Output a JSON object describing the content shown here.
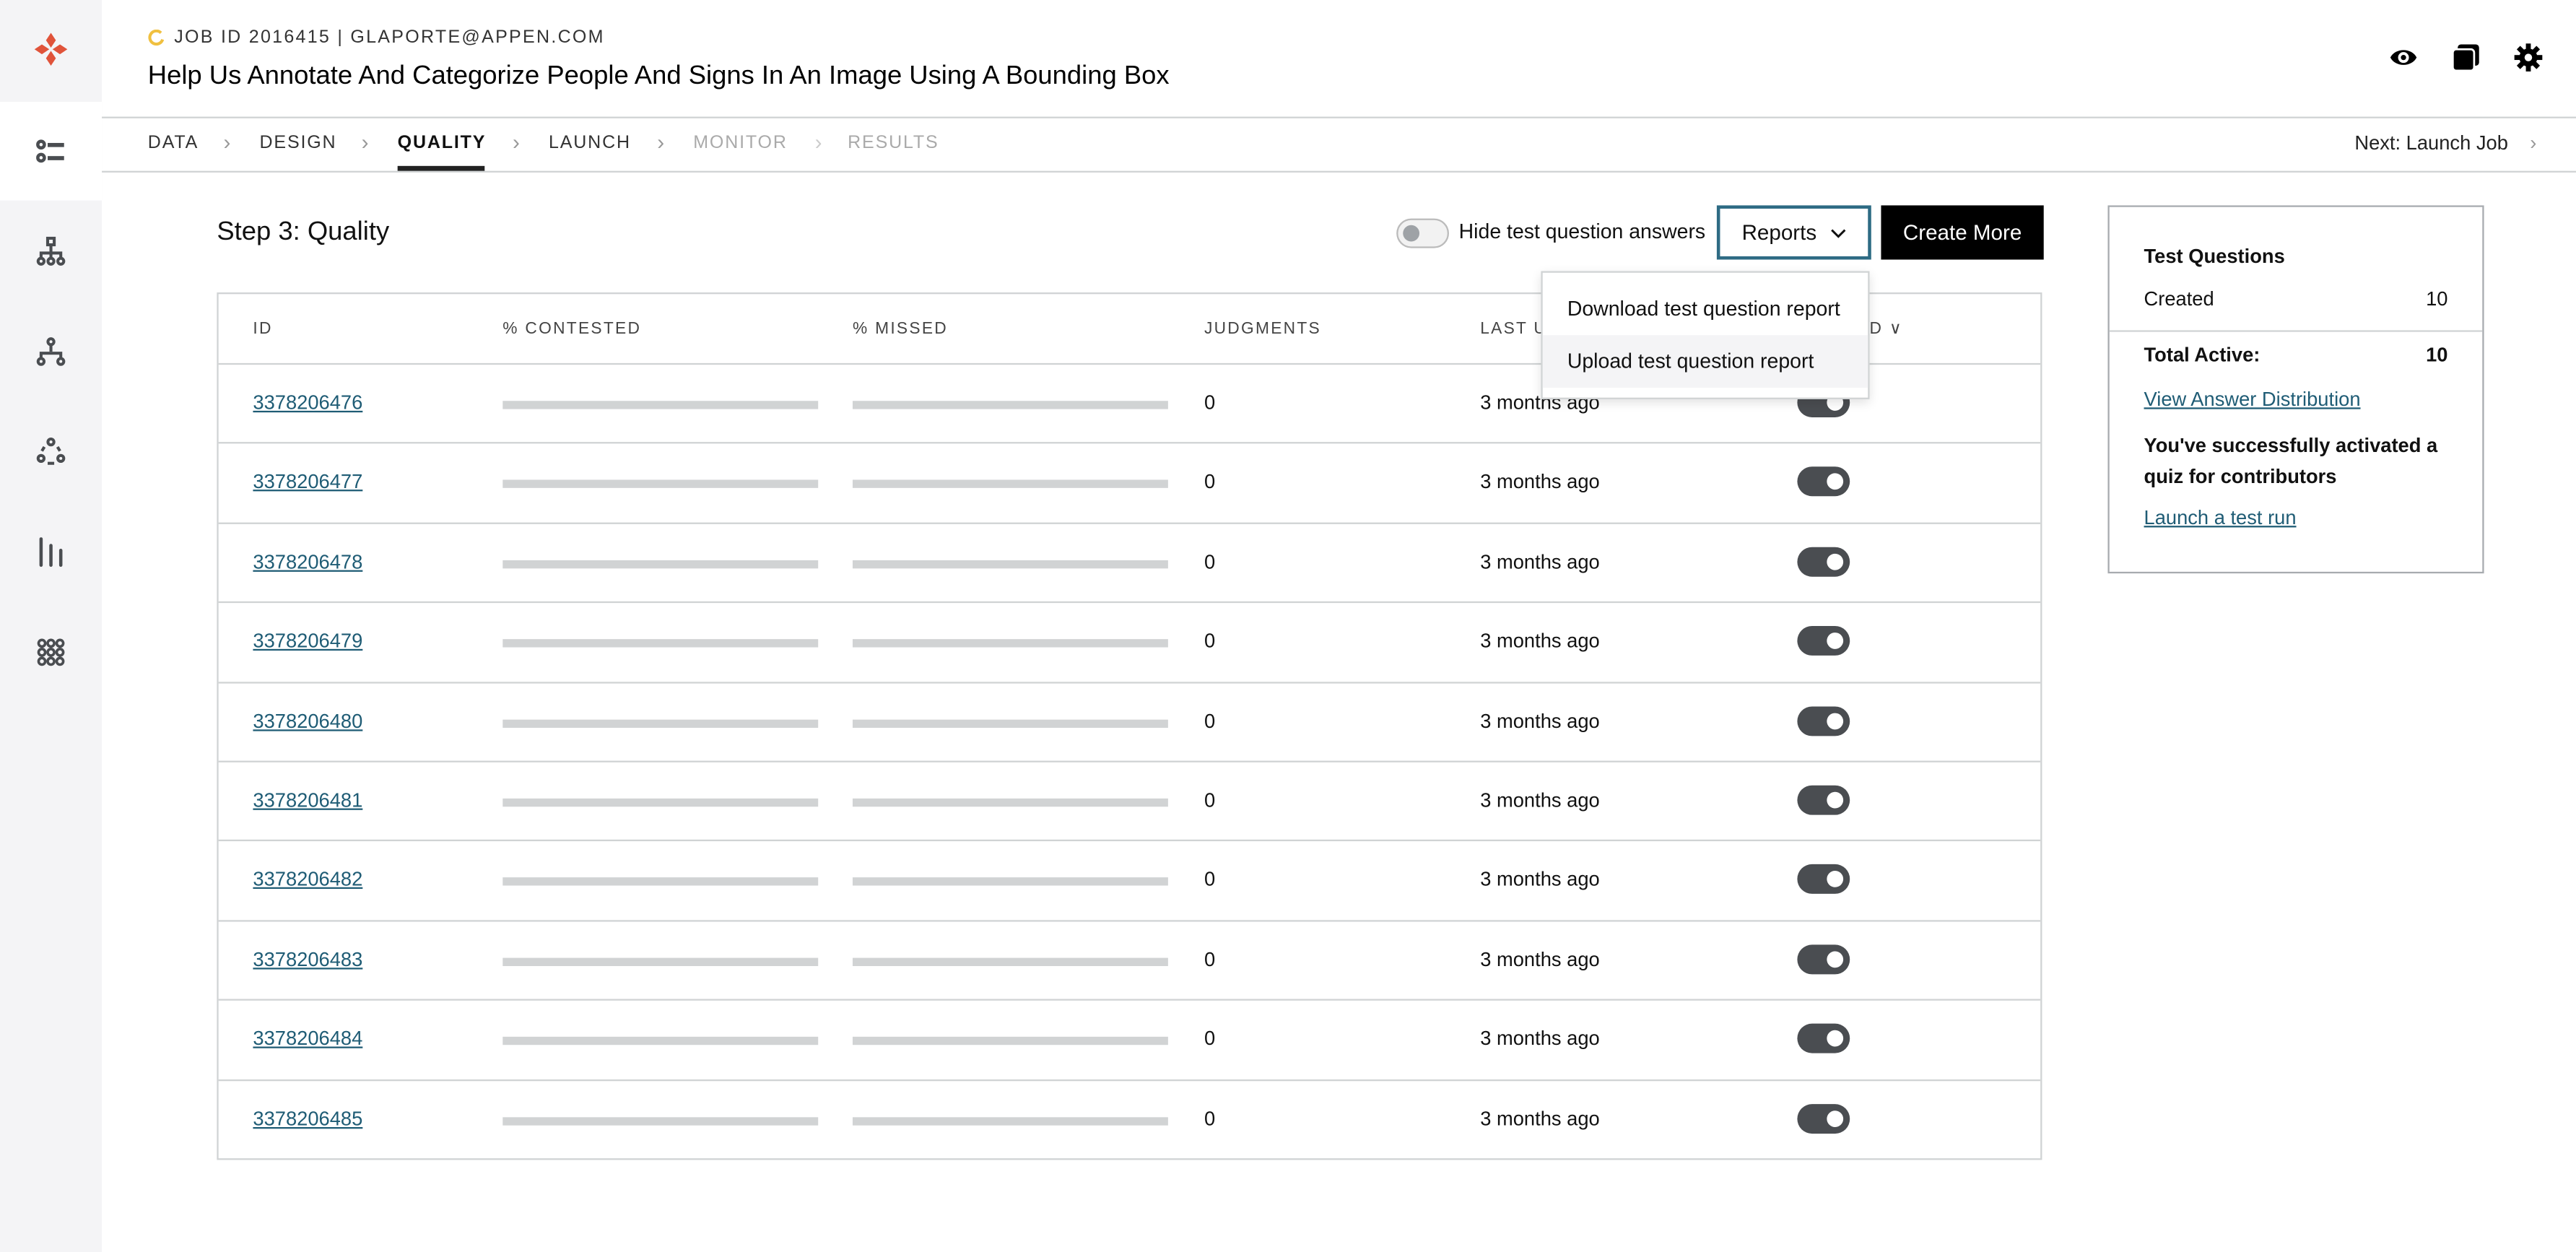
{
  "header": {
    "job_line": "JOB ID 2016415 | GLAPORTE@APPEN.COM",
    "title": "Help Us Annotate And Categorize People And Signs In An Image Using A Bounding Box",
    "icons": [
      "eye-icon",
      "copy-icon",
      "gear-icon"
    ]
  },
  "colors": {
    "brand": "#e0533a",
    "link": "#1f5c75",
    "status_spinner": "#f0c040"
  },
  "nav": {
    "tabs": [
      {
        "label": "DATA",
        "state": "done"
      },
      {
        "label": "DESIGN",
        "state": "done"
      },
      {
        "label": "QUALITY",
        "state": "active"
      },
      {
        "label": "LAUNCH",
        "state": "done"
      },
      {
        "label": "MONITOR",
        "state": "disabled"
      },
      {
        "label": "RESULTS",
        "state": "disabled"
      }
    ],
    "next": "Next: Launch Job"
  },
  "main": {
    "step_title": "Step 3: Quality",
    "hide_toggle_label": "Hide test question answers",
    "hide_toggle_on": false,
    "reports_label": "Reports",
    "create_label": "Create More"
  },
  "dropdown": {
    "items": [
      "Download test question report",
      "Upload test question report"
    ]
  },
  "table": {
    "headers": [
      "ID",
      "% CONTESTED",
      "% MISSED",
      "JUDGMENTS",
      "LAST U",
      "D"
    ],
    "rows": [
      {
        "id": "3378206476",
        "judgments": "0",
        "updated": "3 months ago",
        "active": true
      },
      {
        "id": "3378206477",
        "judgments": "0",
        "updated": "3 months ago",
        "active": true
      },
      {
        "id": "3378206478",
        "judgments": "0",
        "updated": "3 months ago",
        "active": true
      },
      {
        "id": "3378206479",
        "judgments": "0",
        "updated": "3 months ago",
        "active": true
      },
      {
        "id": "3378206480",
        "judgments": "0",
        "updated": "3 months ago",
        "active": true
      },
      {
        "id": "3378206481",
        "judgments": "0",
        "updated": "3 months ago",
        "active": true
      },
      {
        "id": "3378206482",
        "judgments": "0",
        "updated": "3 months ago",
        "active": true
      },
      {
        "id": "3378206483",
        "judgments": "0",
        "updated": "3 months ago",
        "active": true
      },
      {
        "id": "3378206484",
        "judgments": "0",
        "updated": "3 months ago",
        "active": true
      },
      {
        "id": "3378206485",
        "judgments": "0",
        "updated": "3 months ago",
        "active": true
      }
    ]
  },
  "card": {
    "title": "Test Questions",
    "created_label": "Created",
    "created_value": "10",
    "total_label": "Total Active:",
    "total_value": "10",
    "distribution_link": "View Answer Distribution",
    "message": "You've successfully activated a quiz for contributors",
    "test_run_link": "Launch a test run"
  }
}
